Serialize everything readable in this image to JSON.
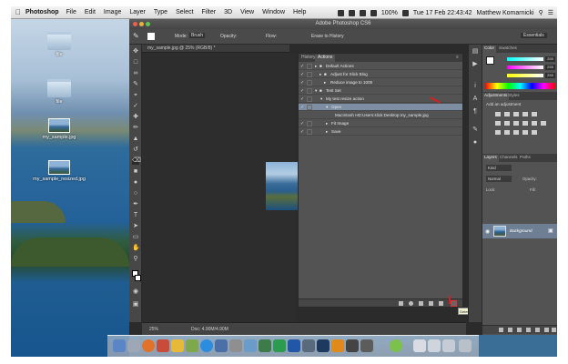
{
  "menubar": {
    "apple": "",
    "app": "Photoshop",
    "items": [
      "File",
      "Edit",
      "Image",
      "Layer",
      "Type",
      "Select",
      "Filter",
      "3D",
      "View",
      "Window",
      "Help"
    ],
    "battery": "100%",
    "clock": "Tue 17 Feb  22:43:42",
    "user": "Matthew Komarnicki"
  },
  "desktop": {
    "icons": [
      {
        "label": "file",
        "kind": "folder-icon"
      },
      {
        "label": "file",
        "kind": "folder-icon"
      },
      {
        "label": "my_sample.jpg",
        "kind": "image-file-icon"
      },
      {
        "label": "my_sample_resized.jpg",
        "kind": "image-file-icon"
      }
    ]
  },
  "photoshop": {
    "title": "Adobe Photoshop CS6",
    "options": {
      "mode_label": "Mode:",
      "mode_value": "Brush",
      "opacity_label": "Opacity:",
      "flow_label": "Flow:",
      "erase_history": "Erase to History",
      "workspace": "Essentials"
    },
    "doc_tab": "my_sample.jpg @ 25% (RGB/8) *",
    "status": {
      "zoom": "25%",
      "doc": "Doc: 4.90M/4.90M"
    },
    "actions_panel": {
      "tabs": [
        "History",
        "Actions"
      ],
      "rows": [
        {
          "label": "Default Actions",
          "type": "set"
        },
        {
          "label": "Adjust for Slick Blog",
          "type": "action"
        },
        {
          "label": "Reduce image to 1000",
          "type": "action"
        },
        {
          "label": "Test Set",
          "type": "set"
        },
        {
          "label": "My test resize action",
          "type": "action"
        },
        {
          "label": "Open",
          "type": "step"
        },
        {
          "label": "Macintosh HD:Users:slick:Desktop:my_sample.jpg",
          "type": "detail"
        },
        {
          "label": "Fit Image",
          "type": "step"
        },
        {
          "label": "Save",
          "type": "step"
        }
      ],
      "tooltip": "Delete"
    },
    "dock": {
      "color_tabs": [
        "Color",
        "Swatches"
      ],
      "rgb_values": [
        "255",
        "255",
        "255"
      ],
      "adjust_tabs": [
        "Adjustments",
        "Styles"
      ],
      "adjust_heading": "Add an adjustment",
      "layer_tabs": [
        "Layers",
        "Channels",
        "Paths"
      ],
      "kind": "Kind",
      "blend_mode": "Normal",
      "opacity_label": "Opacity:",
      "fill_label": "Fill:",
      "lock_label": "Lock:",
      "layer_name": "Background"
    }
  },
  "colors": {
    "ps_panel": "#535353",
    "selection": "#7d8ea3",
    "annotation": "#d42020"
  }
}
